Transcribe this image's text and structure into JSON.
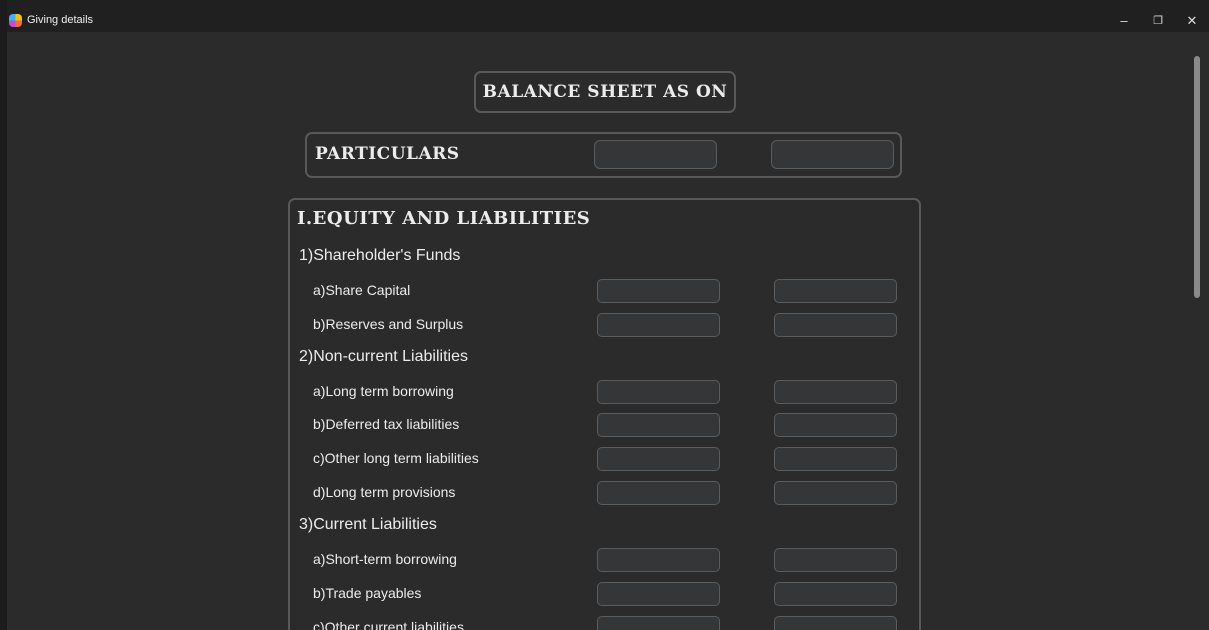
{
  "window": {
    "title": "Giving details",
    "minimize_glyph": "–",
    "restore_glyph": "❐",
    "close_glyph": "✕"
  },
  "heading": {
    "text": "BALANCE SHEET AS ON"
  },
  "particulars": {
    "label": "PARTICULARS",
    "year1_value": "",
    "year2_value": ""
  },
  "section": {
    "title": "I.EQUITY AND LIABILITIES",
    "groups": [
      {
        "label": "1)Shareholder's Funds",
        "items": [
          {
            "label": "a)Share Capital",
            "col1": "",
            "col2": ""
          },
          {
            "label": "b)Reserves and Surplus",
            "col1": "",
            "col2": ""
          }
        ]
      },
      {
        "label": "2)Non-current Liabilities",
        "items": [
          {
            "label": "a)Long term borrowing",
            "col1": "",
            "col2": ""
          },
          {
            "label": "b)Deferred tax liabilities",
            "col1": "",
            "col2": ""
          },
          {
            "label": "c)Other long term liabilities",
            "col1": "",
            "col2": ""
          },
          {
            "label": "d)Long term provisions",
            "col1": "",
            "col2": ""
          }
        ]
      },
      {
        "label": "3)Current Liabilities",
        "items": [
          {
            "label": "a)Short-term borrowing",
            "col1": "",
            "col2": ""
          },
          {
            "label": "b)Trade payables",
            "col1": "",
            "col2": ""
          },
          {
            "label": "c)Other current liabilities",
            "col1": "",
            "col2": ""
          }
        ]
      }
    ]
  },
  "colors": {
    "background": "#2b2b2b",
    "frame_border": "#595959",
    "input_fill": "#343638",
    "input_border": "#5a5c5e",
    "text": "#ececec"
  },
  "icons": {
    "app": "app-icon",
    "minimize": "minimize-icon",
    "restore": "restore-icon",
    "close": "close-icon"
  }
}
